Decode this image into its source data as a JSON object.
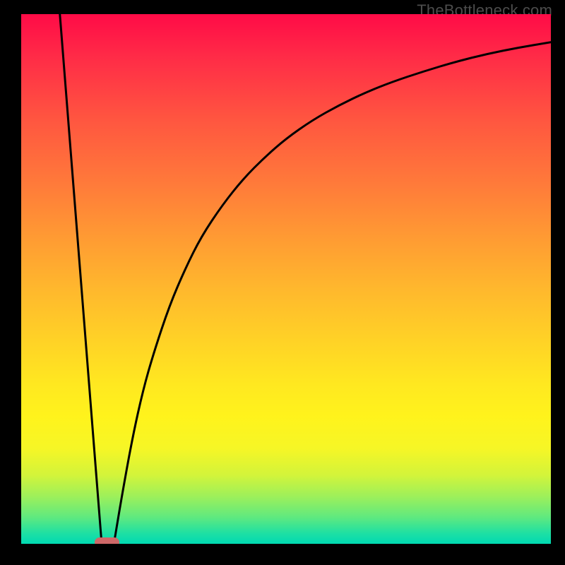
{
  "watermark": "TheBottleneck.com",
  "chart_data": {
    "type": "line",
    "title": "",
    "xlabel": "",
    "ylabel": "",
    "xlim": [
      0,
      100
    ],
    "ylim": [
      0,
      100
    ],
    "grid": false,
    "series": [
      {
        "name": "left-spike",
        "x": [
          7.3,
          15.2
        ],
        "values": [
          100,
          0
        ]
      },
      {
        "name": "right-curve",
        "x": [
          17.5,
          19,
          21,
          23,
          25,
          28,
          31,
          34,
          38,
          42,
          46,
          50,
          55,
          60,
          65,
          70,
          76,
          82,
          88,
          94,
          100
        ],
        "values": [
          0,
          9,
          20,
          29,
          36,
          45,
          52,
          58,
          64,
          69,
          73,
          76.5,
          80,
          82.8,
          85.2,
          87.2,
          89.2,
          91,
          92.5,
          93.7,
          94.7
        ]
      }
    ],
    "marker": {
      "name": "target-marker",
      "x_start": 13.9,
      "x_end": 18.5,
      "y": 0,
      "color": "#ce6868"
    },
    "gradient_stops": [
      {
        "pos": 0,
        "color": "#ff0b47"
      },
      {
        "pos": 8,
        "color": "#ff2b47"
      },
      {
        "pos": 20,
        "color": "#ff5640"
      },
      {
        "pos": 32,
        "color": "#ff7a3a"
      },
      {
        "pos": 42,
        "color": "#ff9a33"
      },
      {
        "pos": 52,
        "color": "#ffb82d"
      },
      {
        "pos": 62,
        "color": "#ffd326"
      },
      {
        "pos": 70,
        "color": "#ffe820"
      },
      {
        "pos": 76,
        "color": "#fff31c"
      },
      {
        "pos": 82,
        "color": "#f6f626"
      },
      {
        "pos": 87,
        "color": "#d3f43a"
      },
      {
        "pos": 91,
        "color": "#9ef05a"
      },
      {
        "pos": 95,
        "color": "#5fe97f"
      },
      {
        "pos": 98,
        "color": "#1ee0a3"
      },
      {
        "pos": 100,
        "color": "#00d9b2"
      }
    ]
  }
}
